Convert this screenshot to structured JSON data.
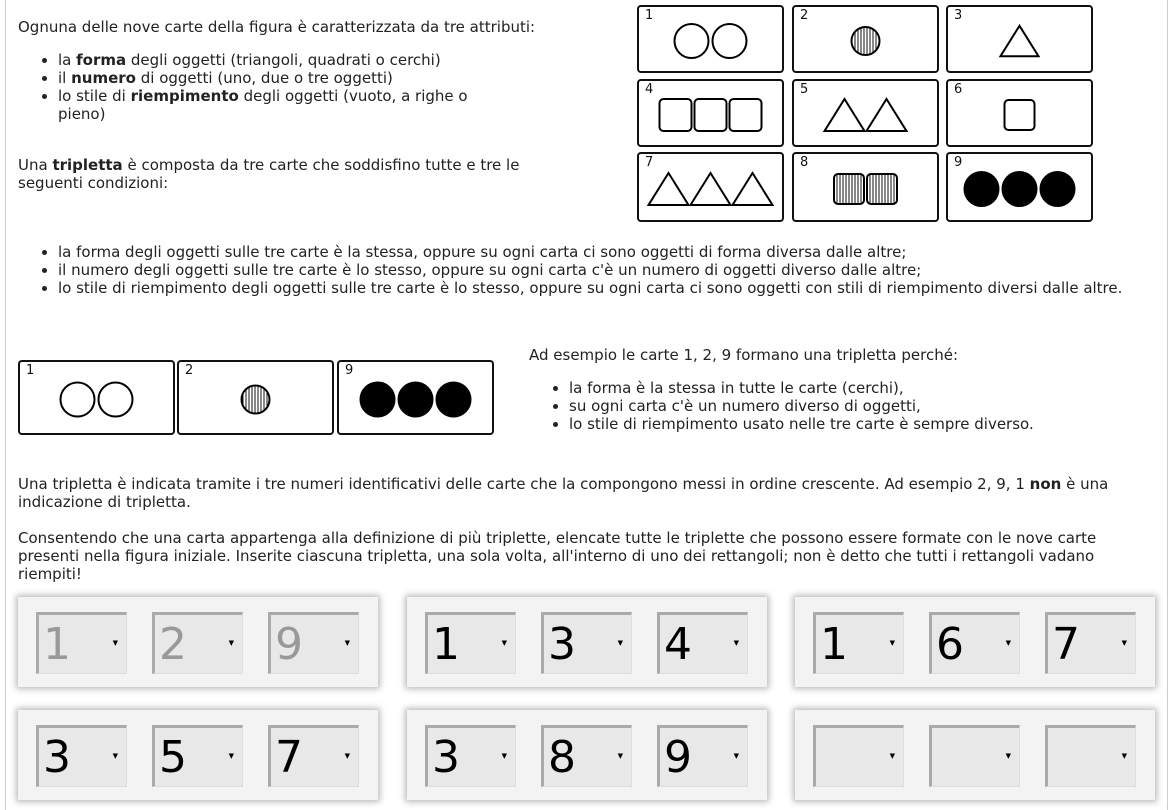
{
  "intro": {
    "p1": "Ognuna delle nove carte della figura è caratterizzata da tre attributi:",
    "attrs": [
      {
        "pre": "la ",
        "bold": "forma",
        "post": " degli oggetti (triangoli, quadrati o cerchi)"
      },
      {
        "pre": "il ",
        "bold": "numero",
        "post": " di oggetti (uno, due o tre oggetti)"
      },
      {
        "pre": "lo stile di ",
        "bold": "riempimento",
        "post": " degli oggetti (vuoto, a righe o pieno)"
      }
    ],
    "p2_pre": "Una ",
    "p2_bold": "tripletta",
    "p2_post": " è composta da tre carte che soddisfino tutte e tre le seguenti condizioni:"
  },
  "conditions": [
    "la forma degli oggetti sulle tre carte è la stessa, oppure su ogni carta ci sono oggetti di forma diversa dalle altre;",
    "il numero degli oggetti sulle tre carte è lo stesso, oppure su ogni carta c'è un numero di oggetti diverso dalle altre;",
    "lo stile di riempimento degli oggetti sulle tre carte è lo stesso, oppure su ogni carta ci sono oggetti con stili di riempimento diversi dalle altre."
  ],
  "cards": [
    {
      "n": "1",
      "shape": "circle",
      "count": 2,
      "fill": "empty"
    },
    {
      "n": "2",
      "shape": "circle",
      "count": 1,
      "fill": "striped"
    },
    {
      "n": "3",
      "shape": "triangle",
      "count": 1,
      "fill": "empty"
    },
    {
      "n": "4",
      "shape": "square",
      "count": 3,
      "fill": "empty"
    },
    {
      "n": "5",
      "shape": "triangle",
      "count": 2,
      "fill": "empty"
    },
    {
      "n": "6",
      "shape": "square",
      "count": 1,
      "fill": "empty"
    },
    {
      "n": "7",
      "shape": "triangle",
      "count": 3,
      "fill": "empty"
    },
    {
      "n": "8",
      "shape": "square",
      "count": 2,
      "fill": "striped"
    },
    {
      "n": "9",
      "shape": "circle",
      "count": 3,
      "fill": "solid"
    }
  ],
  "example": {
    "cards": [
      "1",
      "2",
      "9"
    ],
    "text": "Ad esempio le carte 1, 2, 9 formano una tripletta perché:",
    "reasons": [
      "la forma è la stessa in tutte le carte (cerchi),",
      "su ogni carta c'è un numero diverso di oggetti,",
      "lo stile di riempimento usato nelle tre carte è sempre diverso."
    ]
  },
  "notation": {
    "pre": "Una tripletta è indicata tramite i tre numeri identificativi delle carte che la compongono messi in ordine crescente. Ad esempio 2, 9, 1 ",
    "bold": "non",
    "post": " è una indicazione di tripletta."
  },
  "instructions": "Consentendo che una carta appartenga alla definizione di più triplette, elencate tutte le triplette che possono essere formate con le nove carte presenti nella figura iniziale. Inserite ciascuna tripletta, una sola volta, all'interno di uno dei rettangoli; non è detto che tutti i rettangoli vadano riempiti!",
  "triplets": [
    {
      "values": [
        "1",
        "2",
        "9"
      ],
      "disabled": true
    },
    {
      "values": [
        "1",
        "3",
        "4"
      ],
      "disabled": false
    },
    {
      "values": [
        "1",
        "6",
        "7"
      ],
      "disabled": false
    },
    {
      "values": [
        "3",
        "5",
        "7"
      ],
      "disabled": false
    },
    {
      "values": [
        "3",
        "8",
        "9"
      ],
      "disabled": false
    },
    {
      "values": [
        "",
        "",
        ""
      ],
      "disabled": false
    }
  ],
  "icons": {
    "dropdown": "dropdown-arrow-icon"
  }
}
